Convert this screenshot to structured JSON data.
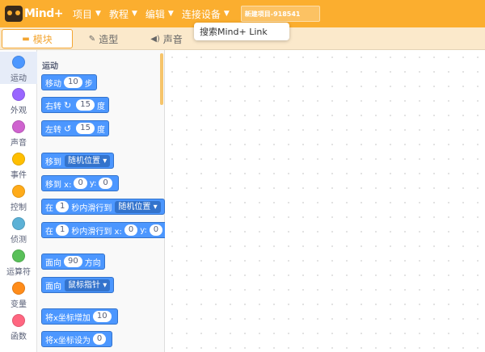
{
  "menubar": {
    "brand": "Mind+",
    "items": [
      {
        "label": "项目"
      },
      {
        "label": "教程"
      },
      {
        "label": "编辑"
      },
      {
        "label": "连接设备"
      }
    ],
    "project_name": "新建项目-918541",
    "accent_color": "#fbae2f"
  },
  "popover": {
    "label": "搜索Mind+ Link"
  },
  "tabs": [
    {
      "label": "模块",
      "icon": "blocks-icon",
      "active": true
    },
    {
      "label": "造型",
      "icon": "brush-icon",
      "active": false
    },
    {
      "label": "声音",
      "icon": "speaker-icon",
      "active": false
    }
  ],
  "categories": [
    {
      "label": "运动",
      "color": "#4c97ff"
    },
    {
      "label": "外观",
      "color": "#9966ff"
    },
    {
      "label": "声音",
      "color": "#cf63cf"
    },
    {
      "label": "事件",
      "color": "#ffbf00"
    },
    {
      "label": "控制",
      "color": "#ffab19"
    },
    {
      "label": "侦测",
      "color": "#5cb1d6"
    },
    {
      "label": "运算符",
      "color": "#59c059"
    },
    {
      "label": "变量",
      "color": "#ff8c1a"
    },
    {
      "label": "函数",
      "color": "#ff6680"
    }
  ],
  "palette": {
    "section_title": "运动",
    "blocks": {
      "move": {
        "pre": "移动",
        "value": "10",
        "post": "步"
      },
      "turn_right": {
        "pre": "右转",
        "icon": "↻",
        "value": "15",
        "post": "度"
      },
      "turn_left": {
        "pre": "左转",
        "icon": "↺",
        "value": "15",
        "post": "度"
      },
      "goto": {
        "pre": "移到",
        "dropdown": "随机位置"
      },
      "goto_xy": {
        "pre": "移到 x:",
        "x": "0",
        "ymid": "y:",
        "y": "0"
      },
      "glide": {
        "pre": "在",
        "value": "1",
        "mid": "秒内滑行到",
        "dropdown": "随机位置"
      },
      "glide_xy": {
        "pre": "在",
        "value": "1",
        "mid": "秒内滑行到 x:",
        "x": "0",
        "ymid": "y:",
        "y": "0"
      },
      "point_dir": {
        "pre": "面向",
        "value": "90",
        "post": "方向"
      },
      "point_towards": {
        "pre": "面向",
        "dropdown": "鼠标指针"
      },
      "change_x": {
        "pre": "将x坐标增加",
        "value": "10"
      },
      "set_x": {
        "pre": "将x坐标设为",
        "value": "0"
      }
    }
  }
}
